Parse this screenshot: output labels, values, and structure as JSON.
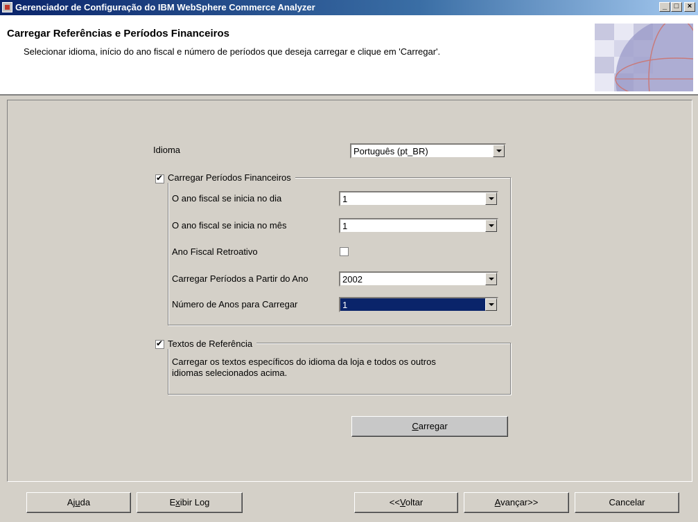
{
  "window": {
    "title": "Gerenciador de Configuração do IBM WebSphere Commerce Analyzer",
    "controls": [
      "minimize-icon",
      "maximize-icon",
      "close-icon"
    ]
  },
  "header": {
    "title": "Carregar Referências e Períodos Financeiros",
    "description": "Selecionar idioma, início do ano fiscal e número de períodos que deseja carregar e clique em 'Carregar'."
  },
  "form": {
    "language_label": "Idioma",
    "language_value": "Português (pt_BR)",
    "fiscal_group": {
      "label": "Carregar Períodos Financeiros",
      "checked": true,
      "start_day_label": "O ano fiscal se inicia no dia",
      "start_day_value": "1",
      "start_month_label": "O ano fiscal se inicia no mês",
      "start_month_value": "1",
      "retroactive_label": "Ano Fiscal Retroativo",
      "retroactive_checked": false,
      "from_year_label": "Carregar Períodos a Partir do Ano",
      "from_year_value": "2002",
      "num_years_label": "Número de Anos para Carregar",
      "num_years_value": "1"
    },
    "reference_group": {
      "label": "Textos de Referência",
      "checked": true,
      "description_line1": "Carregar os textos específicos do idioma da loja e todos os outros",
      "description_line2": "idiomas selecionados acima."
    },
    "load_button": {
      "mnemonic": "C",
      "rest": "arregar"
    }
  },
  "footer": {
    "help": {
      "pre": "Aj",
      "mnemonic": "u",
      "post": "da"
    },
    "log": {
      "pre": "E",
      "mnemonic": "x",
      "post": "ibir Log"
    },
    "back": {
      "pre": "<<",
      "mnemonic": "V",
      "post": "oltar"
    },
    "next": {
      "pre": "",
      "mnemonic": "A",
      "post": "vançar>>"
    },
    "cancel": "Cancelar"
  },
  "colors": {
    "titlebar_start": "#0a246a",
    "selected_field": "#0a246a",
    "window_bg": "#d4d0c8"
  }
}
